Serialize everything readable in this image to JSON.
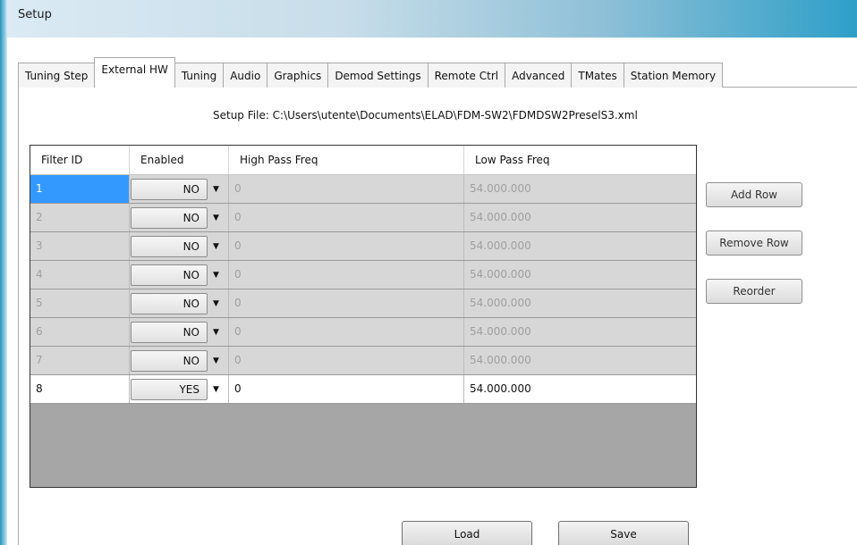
{
  "window": {
    "title": "Setup"
  },
  "tabs": [
    {
      "label": "Tuning Step",
      "active": false
    },
    {
      "label": "External HW",
      "active": true
    },
    {
      "label": "Tuning",
      "active": false
    },
    {
      "label": "Audio",
      "active": false
    },
    {
      "label": "Graphics",
      "active": false
    },
    {
      "label": "Demod Settings",
      "active": false
    },
    {
      "label": "Remote Ctrl",
      "active": false
    },
    {
      "label": "Advanced",
      "active": false
    },
    {
      "label": "TMates",
      "active": false
    },
    {
      "label": "Station Memory",
      "active": false
    }
  ],
  "setup_file": "Setup File: C:\\Users\\utente\\Documents\\ELAD\\FDM-SW2\\FDMDSW2PreselS3.xml",
  "grid": {
    "columns": [
      "Filter ID",
      "Enabled",
      "High Pass Freq",
      "Low Pass Freq"
    ],
    "rows": [
      {
        "id": "1",
        "enabled": "NO",
        "high_pass": "0",
        "low_pass": "54.000.000",
        "selected": true
      },
      {
        "id": "2",
        "enabled": "NO",
        "high_pass": "0",
        "low_pass": "54.000.000"
      },
      {
        "id": "3",
        "enabled": "NO",
        "high_pass": "0",
        "low_pass": "54.000.000"
      },
      {
        "id": "4",
        "enabled": "NO",
        "high_pass": "0",
        "low_pass": "54.000.000"
      },
      {
        "id": "5",
        "enabled": "NO",
        "high_pass": "0",
        "low_pass": "54.000.000"
      },
      {
        "id": "6",
        "enabled": "NO",
        "high_pass": "0",
        "low_pass": "54.000.000"
      },
      {
        "id": "7",
        "enabled": "NO",
        "high_pass": "0",
        "low_pass": "54.000.000"
      },
      {
        "id": "8",
        "enabled": "YES",
        "high_pass": "0",
        "low_pass": "54.000.000"
      }
    ]
  },
  "buttons": {
    "add_row": "Add Row",
    "remove_row": "Remove Row",
    "reorder": "Reorder",
    "load": "Load",
    "save": "Save"
  },
  "icons": {
    "dropdown": "chevron-down-icon",
    "dropdown_glyph": "▼"
  },
  "colors": {
    "selection": "#3399ff",
    "disabled_row": "#d7d7d7",
    "empty_grid": "#a6a6a6"
  }
}
